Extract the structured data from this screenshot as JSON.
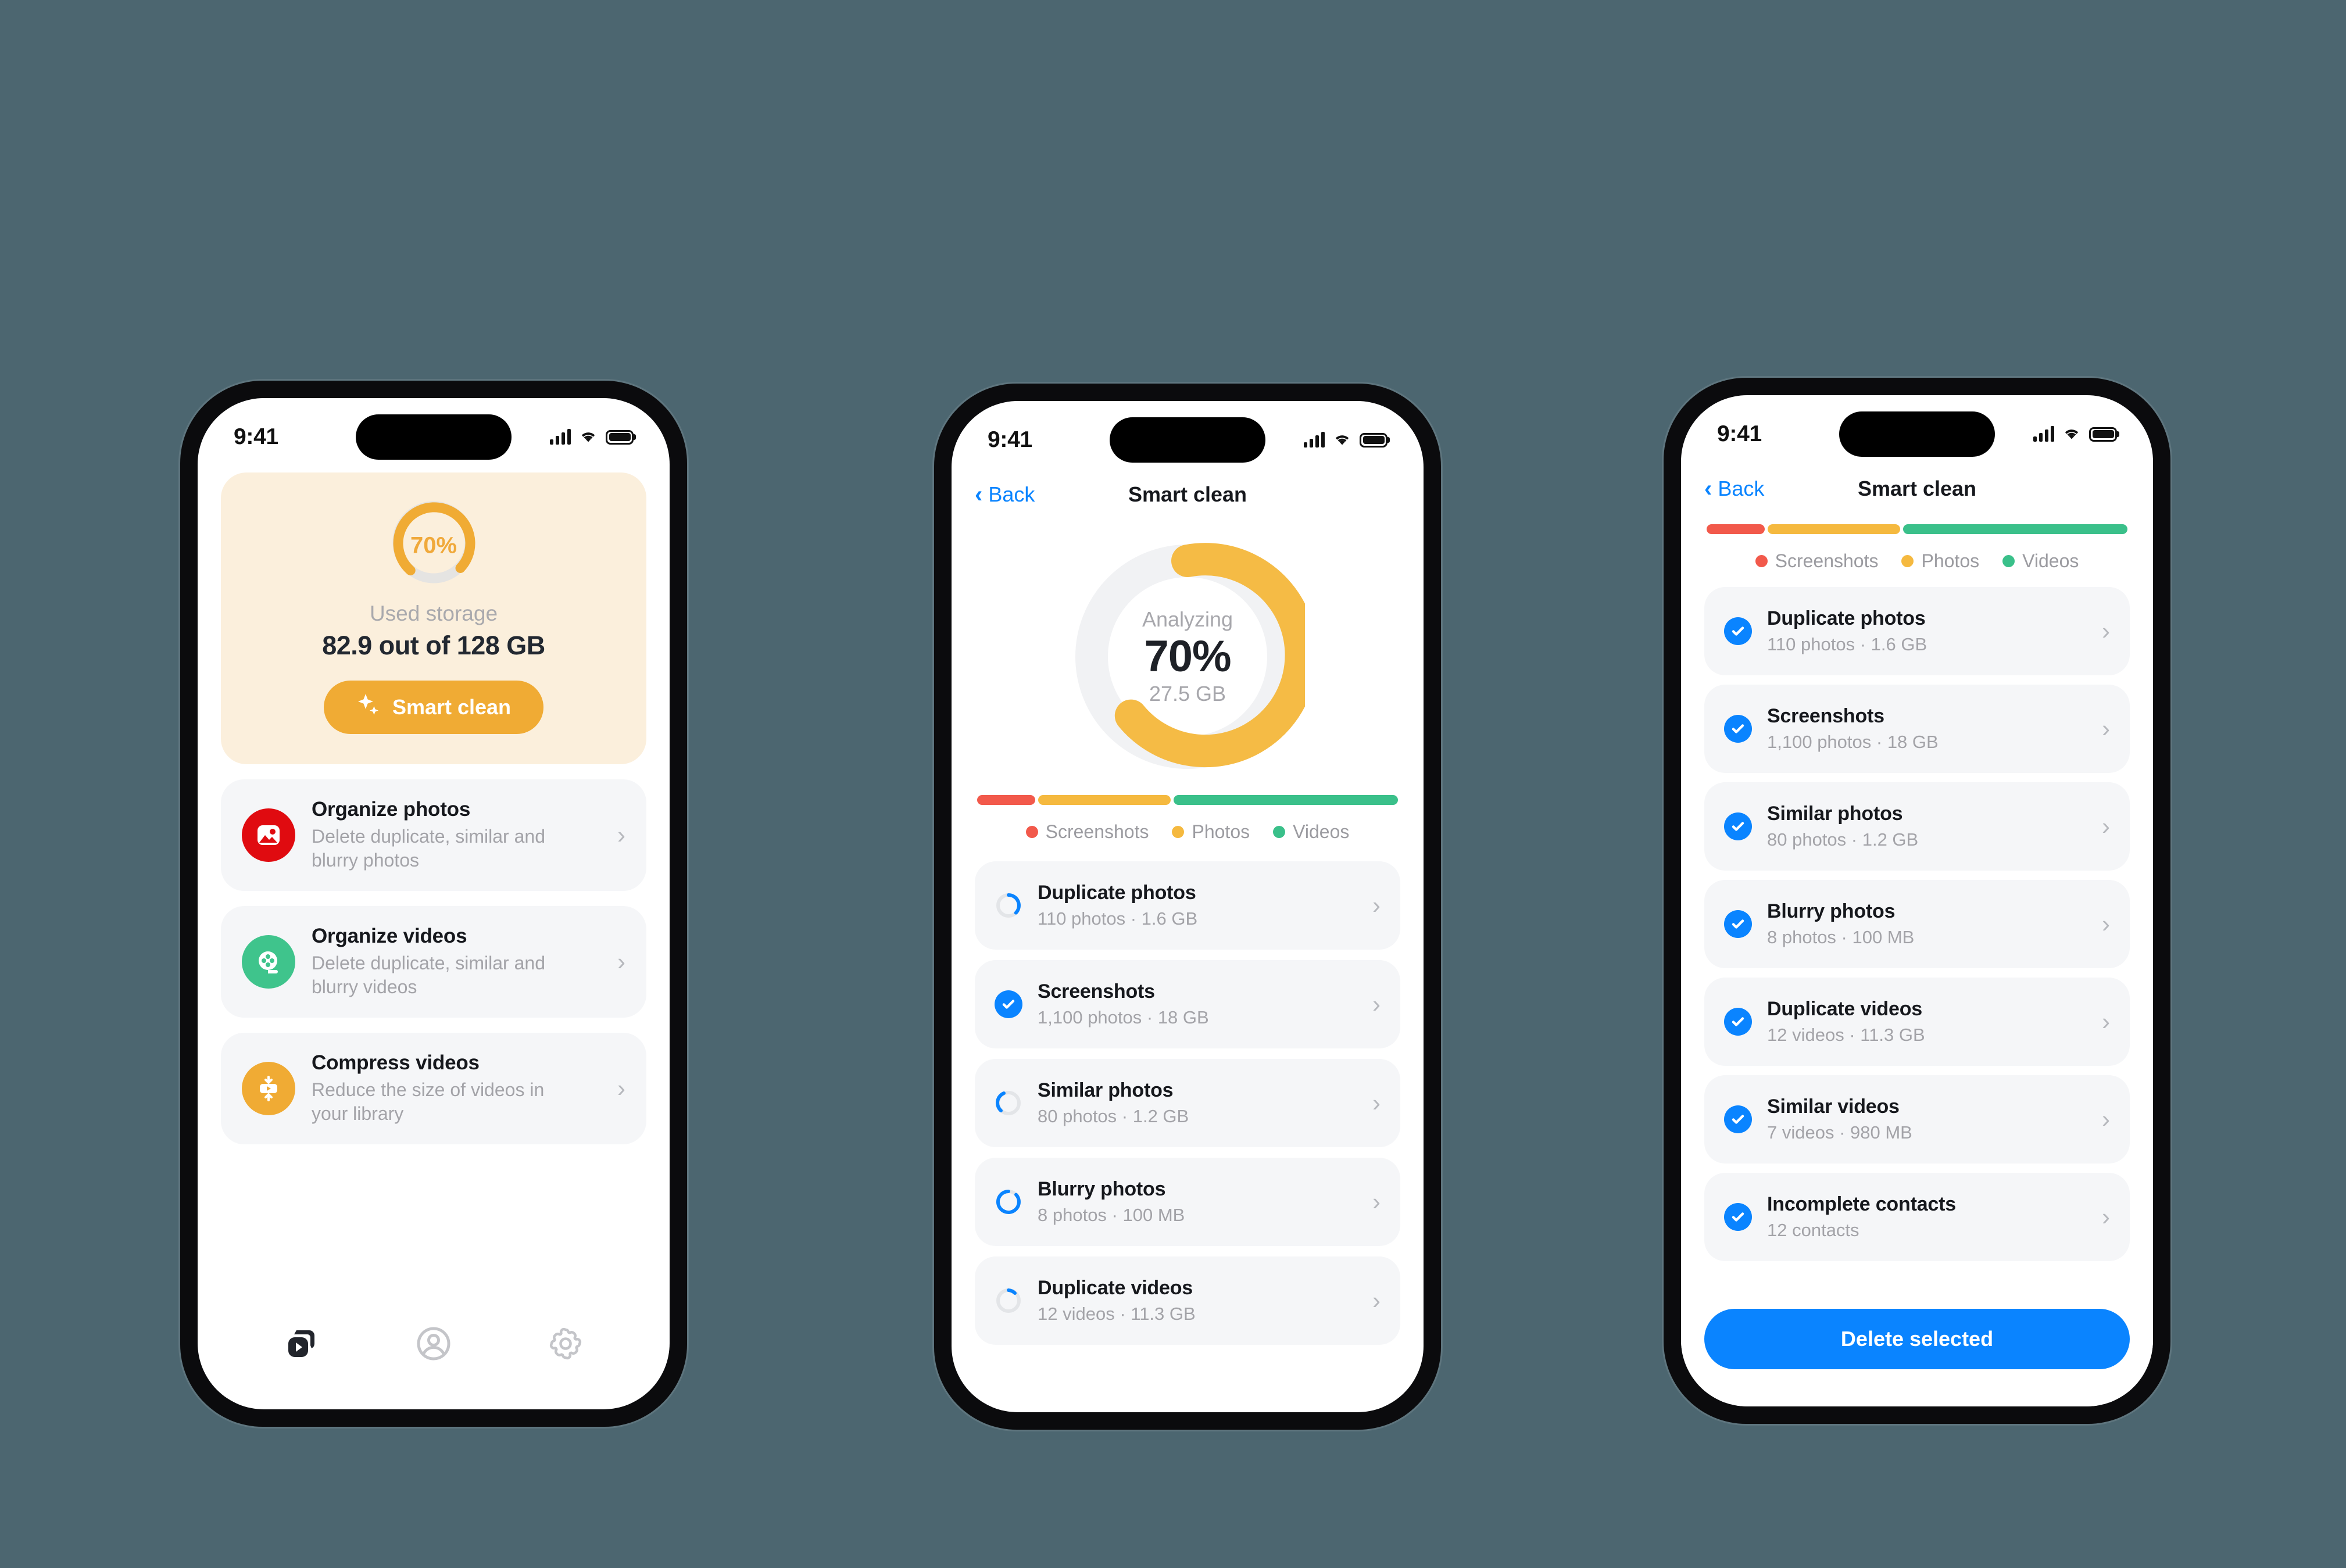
{
  "colors": {
    "backdrop": "#4c6670",
    "amber": "#f0ab34",
    "amber_light": "#f7c95c",
    "cream": "#fbefdc",
    "blue": "#0a84ff",
    "red": "#f2594b",
    "green": "#3ac08a",
    "track": "#eceef0"
  },
  "status_bar": {
    "time": "9:41",
    "signal_icon": "cellular-signal-icon",
    "wifi_icon": "wifi-icon",
    "battery_icon": "battery-icon"
  },
  "screen1": {
    "storage_card": {
      "gauge_percent_label": "70%",
      "gauge_percent": 70,
      "used_label": "Used storage",
      "used_value": "82.9 out of 128 GB",
      "smart_clean_label": "Smart clean",
      "sparkle_icon": "sparkle-icon"
    },
    "features": [
      {
        "title": "Organize photos",
        "subtitle": "Delete duplicate, similar and blurry photos",
        "icon": "photo-icon",
        "icon_bg": "#e00b10",
        "chevron": "chevron-right-icon"
      },
      {
        "title": "Organize videos",
        "subtitle": "Delete duplicate, similar and blurry videos",
        "icon": "film-reel-icon",
        "icon_bg": "#3fc48c",
        "chevron": "chevron-right-icon"
      },
      {
        "title": "Compress videos",
        "subtitle": "Reduce the size of videos in your library",
        "icon": "compress-video-icon",
        "icon_bg": "#f0ab34",
        "chevron": "chevron-right-icon"
      }
    ],
    "tabs": [
      {
        "name": "media-tab",
        "icon": "media-play-stack-icon",
        "active": true
      },
      {
        "name": "account-tab",
        "icon": "account-circle-icon",
        "active": false
      },
      {
        "name": "settings-tab",
        "icon": "gear-icon",
        "active": false
      }
    ]
  },
  "screen2": {
    "nav": {
      "back_label": "Back",
      "title": "Smart clean",
      "back_icon": "chevron-left-icon"
    },
    "donut": {
      "status": "Analyzing",
      "percent_label": "70%",
      "percent": 70,
      "size_label": "27.5 GB"
    },
    "rows": [
      {
        "title": "Duplicate photos",
        "subtitle": "110 photos · 1.6 GB",
        "state": "loading",
        "chevron": "chevron-right-icon"
      },
      {
        "title": "Screenshots",
        "subtitle": "1,100 photos · 18 GB",
        "state": "checked",
        "chevron": "chevron-right-icon"
      },
      {
        "title": "Similar photos",
        "subtitle": "80 photos · 1.2 GB",
        "state": "loading",
        "chevron": "chevron-right-icon"
      },
      {
        "title": "Blurry photos",
        "subtitle": "8 photos · 100 MB",
        "state": "loading",
        "chevron": "chevron-right-icon"
      },
      {
        "title": "Duplicate videos",
        "subtitle": "12 videos · 11.3 GB",
        "state": "loading",
        "chevron": "chevron-right-icon"
      }
    ]
  },
  "screen3": {
    "nav": {
      "back_label": "Back",
      "title": "Smart clean",
      "back_icon": "chevron-left-icon"
    },
    "rows": [
      {
        "title": "Duplicate photos",
        "subtitle": "110 photos · 1.6 GB",
        "state": "checked",
        "chevron": "chevron-right-icon"
      },
      {
        "title": "Screenshots",
        "subtitle": "1,100 photos · 18 GB",
        "state": "checked",
        "chevron": "chevron-right-icon"
      },
      {
        "title": "Similar photos",
        "subtitle": "80 photos · 1.2 GB",
        "state": "checked",
        "chevron": "chevron-right-icon"
      },
      {
        "title": "Blurry photos",
        "subtitle": "8 photos · 100 MB",
        "state": "checked",
        "chevron": "chevron-right-icon"
      },
      {
        "title": "Duplicate videos",
        "subtitle": "12 videos · 11.3 GB",
        "state": "checked",
        "chevron": "chevron-right-icon"
      },
      {
        "title": "Similar videos",
        "subtitle": "7 videos · 980 MB",
        "state": "checked",
        "chevron": "chevron-right-icon"
      },
      {
        "title": "Incomplete contacts",
        "subtitle": "12 contacts",
        "state": "checked",
        "chevron": "chevron-right-icon"
      }
    ],
    "delete_label": "Delete selected"
  },
  "chart_data": {
    "type": "bar",
    "title": "Storage breakdown by media category",
    "categories": [
      "Screenshots",
      "Photos",
      "Videos"
    ],
    "values": [
      14,
      32,
      54
    ],
    "unit": "percent of bar width",
    "colors": [
      "#f2594b",
      "#f5b93f",
      "#3ac08a"
    ],
    "legend": [
      "Screenshots",
      "Photos",
      "Videos"
    ],
    "legend_position": "below",
    "grid": false,
    "stacked": true
  }
}
